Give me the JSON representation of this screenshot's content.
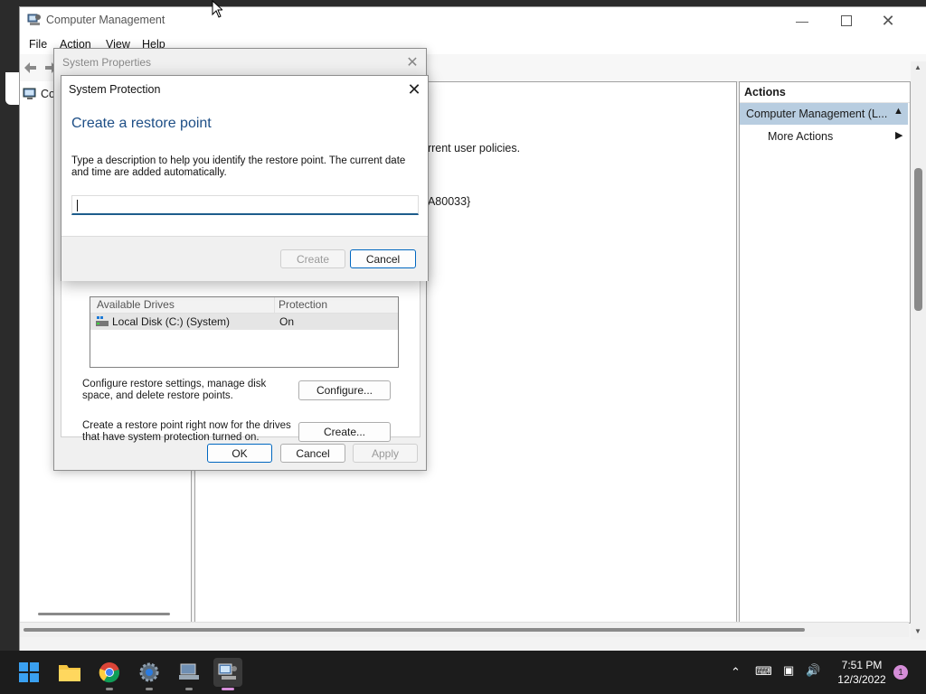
{
  "main_window": {
    "title": "Computer Management",
    "menu": [
      "File",
      "Action",
      "View",
      "Help"
    ],
    "tree_root_label": "Co",
    "center_fragments": {
      "line1": "urrent user policies.",
      "line2": "0A80033}"
    },
    "actions": {
      "header": "Actions",
      "selected": "Computer Management (L...",
      "more": "More Actions"
    }
  },
  "system_properties": {
    "title": "System Properties",
    "drives_header_col1": "Available Drives",
    "drives_header_col2": "Protection",
    "drive_name": "Local Disk (C:) (System)",
    "drive_protection": "On",
    "configure_text": "Configure restore settings, manage disk space, and delete restore points.",
    "configure_button": "Configure...",
    "create_text": "Create a restore point right now for the drives that have system protection turned on.",
    "create_button": "Create...",
    "ok": "OK",
    "cancel": "Cancel",
    "apply": "Apply"
  },
  "system_protection": {
    "title": "System Protection",
    "heading": "Create a restore point",
    "description": "Type a description to help you identify the restore point. The current date and time are added automatically.",
    "input_value": "",
    "create": "Create",
    "cancel": "Cancel"
  },
  "taskbar": {
    "time": "7:51 PM",
    "date": "12/3/2022",
    "notification_count": "1"
  },
  "colors": {
    "accent": "#0067c0",
    "heading_blue": "#1d4e86",
    "actions_selected": "#b8cde0",
    "taskbar": "#1c1c1c"
  }
}
